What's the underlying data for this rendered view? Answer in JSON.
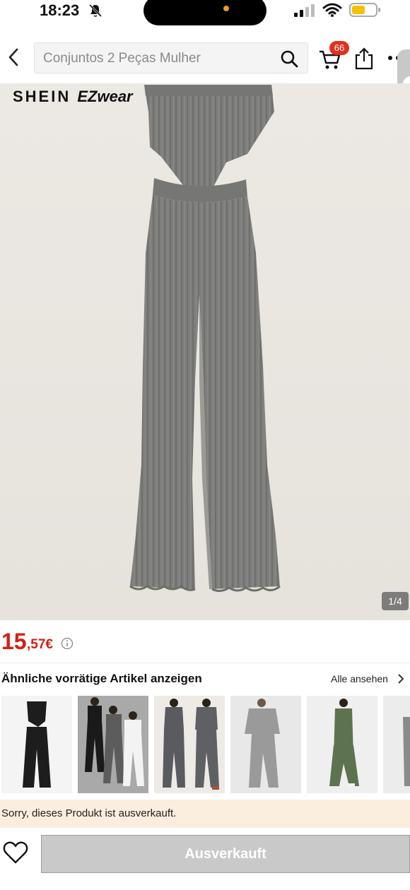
{
  "status_bar": {
    "time": "18:23",
    "icons": [
      "bell-slash-icon",
      "signal-icon",
      "wifi-icon",
      "battery-icon"
    ]
  },
  "header": {
    "search_placeholder": "Conjuntos 2 Peças Mulher",
    "cart_badge": "66",
    "icons": [
      "back-icon",
      "search-icon",
      "cart-icon",
      "share-icon",
      "more-icon"
    ]
  },
  "gallery": {
    "brand_logo": "SHEIN EZwear",
    "brand_logo_main": "SHEIN ",
    "brand_logo_sub": "EZwear",
    "page_indicator": "1/4"
  },
  "price": {
    "integer": "15",
    "decimal": ",57€",
    "color": "#d21f14"
  },
  "similar": {
    "title": "Ähnliche vorrätige Artikel anzeigen",
    "see_all": "Alle ansehen",
    "items": [
      {
        "name": "black-set"
      },
      {
        "name": "three-color-sets"
      },
      {
        "name": "grey-hoodie-set"
      },
      {
        "name": "grey-knit-set"
      },
      {
        "name": "green-set"
      },
      {
        "name": "partial-item"
      }
    ]
  },
  "notice": {
    "text": "Sorry, dieses Produkt ist ausverkauft."
  },
  "footer": {
    "button_label": "Ausverkauft",
    "icons": [
      "heart-icon"
    ]
  }
}
